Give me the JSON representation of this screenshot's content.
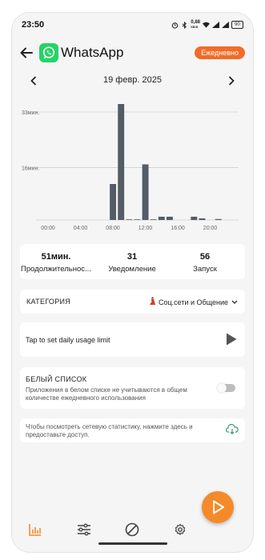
{
  "status_bar": {
    "time": "23:50",
    "speed": "0,88",
    "speed_unit": "КБ/S",
    "battery": "90"
  },
  "header": {
    "back_icon": "arrow-left-icon",
    "app_name": "WhatsApp",
    "frequency_badge": "Ежедневно"
  },
  "date_nav": {
    "date": "19 февр. 2025"
  },
  "chart_data": {
    "type": "bar",
    "categories": [
      "00:00",
      "01:00",
      "02:00",
      "03:00",
      "04:00",
      "05:00",
      "06:00",
      "07:00",
      "08:00",
      "09:00",
      "10:00",
      "11:00",
      "12:00",
      "13:00",
      "14:00",
      "15:00",
      "16:00",
      "17:00",
      "18:00",
      "19:00",
      "20:00",
      "21:00",
      "22:00",
      "23:00"
    ],
    "values": [
      0,
      0,
      0,
      0,
      0,
      0,
      0,
      0,
      11,
      37,
      0.2,
      0.2,
      17,
      0.2,
      1,
      1,
      0,
      0,
      1,
      0.5,
      0,
      0.3,
      0,
      0
    ],
    "x_tick_labels": [
      "00:00",
      "04:00",
      "08:00",
      "12:00",
      "16:00",
      "20:00"
    ],
    "y_tick_labels": [
      "33мин.",
      "16мин."
    ],
    "y_ticks": [
      33,
      16
    ],
    "ylim": [
      0,
      33
    ],
    "grid": true,
    "bar_color": "#545c66"
  },
  "stats": [
    {
      "value": "51мин.",
      "label": "Продолжительнос..."
    },
    {
      "value": "31",
      "label": "Уведомление"
    },
    {
      "value": "56",
      "label": "Запуск"
    }
  ],
  "category": {
    "label": "КАТЕГОРИЯ",
    "value": "Соц.сети и Общение",
    "icon": "dancer-emoji-icon"
  },
  "limit": {
    "label": "Tap to set daily usage limit"
  },
  "whitelist": {
    "title": "БЕЛЫЙ СПИСОК",
    "description": "Приложения в белом списке не учитываются в общем количестве ежедневного использования",
    "enabled": false
  },
  "network": {
    "text": "Чтобы посмотреть сетевую статистику, нажмите здесь и предоставьте доступ."
  },
  "bottom_nav": [
    {
      "name": "stats-icon",
      "active": true
    },
    {
      "name": "sliders-icon",
      "active": false
    },
    {
      "name": "block-icon",
      "active": false
    },
    {
      "name": "gear-icon",
      "active": false
    }
  ],
  "colors": {
    "accent": "#f26b29",
    "fab": "#f58a2a",
    "bar": "#545c66",
    "whatsapp": "#25d366"
  }
}
